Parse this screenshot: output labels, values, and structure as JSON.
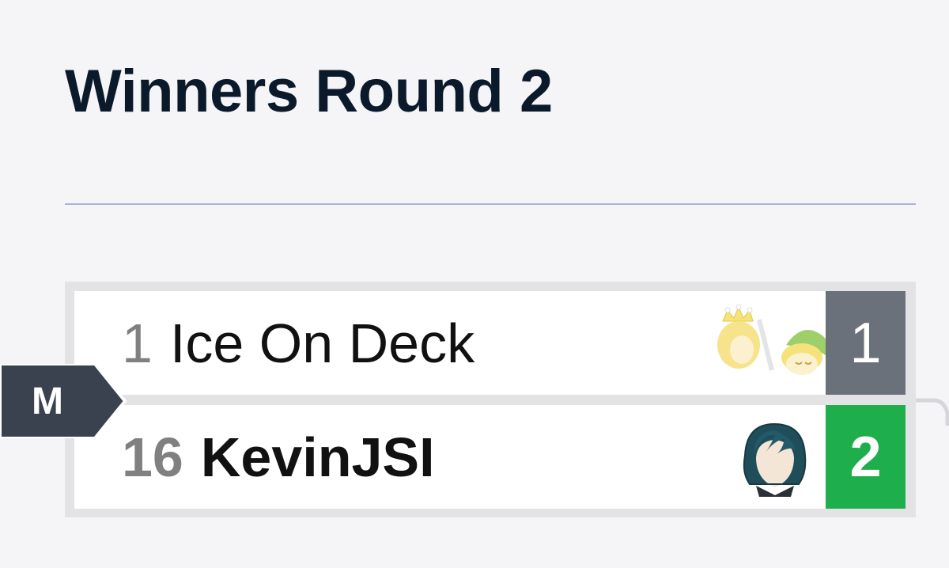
{
  "round": {
    "title": "Winners Round 2"
  },
  "match": {
    "identifier": "M",
    "players": [
      {
        "seed": "1",
        "name": "Ice On Deck",
        "score": "1",
        "characters": [
          "peach-icon",
          "toon-link-icon"
        ]
      },
      {
        "seed": "16",
        "name": "KevinJSI",
        "score": "2",
        "characters": [
          "byleth-icon"
        ]
      }
    ],
    "colors": {
      "loser_score": "#6b717a",
      "winner_score": "#1fae4c",
      "tag": "#3a4250"
    }
  }
}
